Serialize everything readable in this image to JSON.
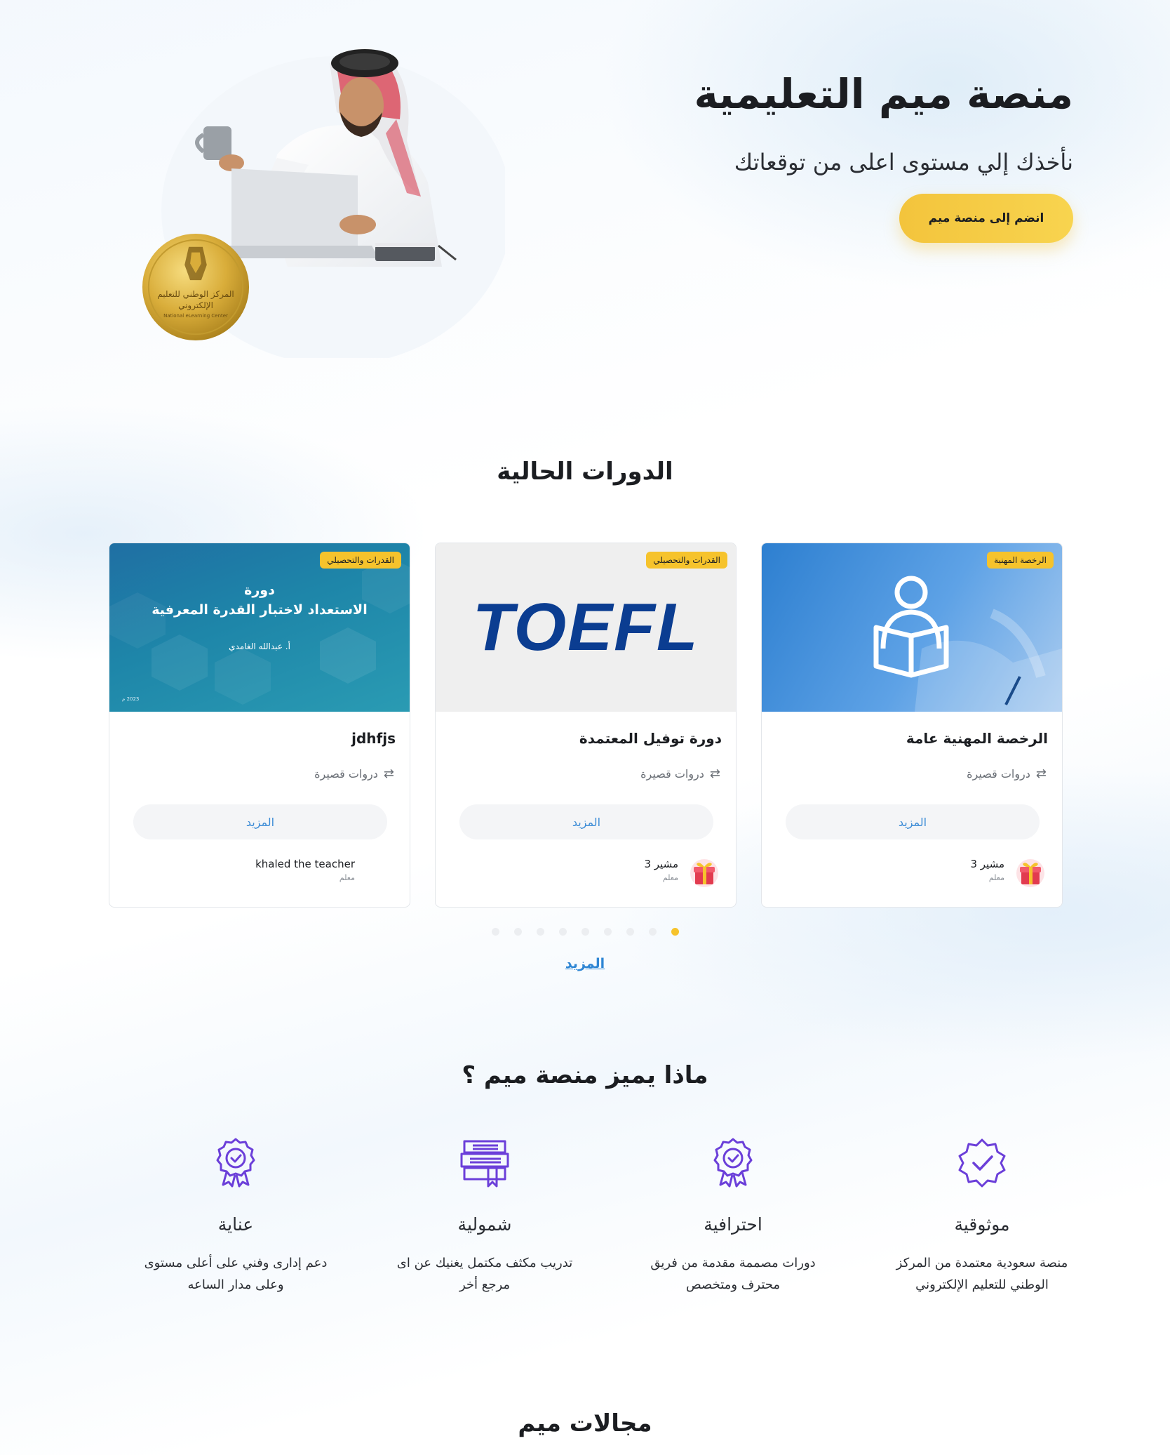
{
  "hero": {
    "title": "منصة ميم التعليمية",
    "subtitle": "نأخذك إلي مستوى اعلى من توقعاتك",
    "join_button": "انضم إلى منصة ميم",
    "badge_text_ar": "المركز الوطني للتعليم الإلكتروني",
    "badge_text_en": "National eLearning Center"
  },
  "courses": {
    "section_title": "الدورات الحالية",
    "items": [
      {
        "tag": "الرخصة المهنية",
        "title": "الرخصة المهنية عامة",
        "meta": "دروات قصيرة",
        "more": "المزيد",
        "instructor_name": "مشير 3",
        "instructor_role": "معلم"
      },
      {
        "tag": "القدرات والتحصيلي",
        "title": "دورة توفيل المعتمدة",
        "meta": "دروات قصيرة",
        "more": "المزيد",
        "instructor_name": "مشير 3",
        "instructor_role": "معلم",
        "image_text": "TOEFL"
      },
      {
        "tag": "القدرات والتحصيلي",
        "title": "jdhfjs",
        "meta": "دروات قصيرة",
        "more": "المزيد",
        "instructor_name": "khaled the teacher",
        "instructor_role": "معلم",
        "image_line1": "دورة",
        "image_line2": "الاستعداد لاختبار القدرة المعرفية",
        "image_author": "أ. عبدالله الغامدي",
        "image_year": "2023 م"
      }
    ],
    "dots_count": 9,
    "active_dot": 0,
    "more_link": "المزيد"
  },
  "features": {
    "section_title": "ماذا يميز منصة ميم ؟",
    "items": [
      {
        "icon": "verified-badge-icon",
        "title": "موثوقية",
        "desc_line1": "منصة سعودية معتمدة من المركز",
        "desc_line2": "الوطني للتعليم الإلكتروني"
      },
      {
        "icon": "award-ribbon-icon",
        "title": "احترافية",
        "desc_line1": "دورات مصممة مقدمة من فريق",
        "desc_line2": "محترف ومتخصص"
      },
      {
        "icon": "books-stack-icon",
        "title": "شمولية",
        "desc_line1": "تدريب مكثف مكتمل يغنيك عن اى",
        "desc_line2": "مرجع أخر"
      },
      {
        "icon": "award-ribbon-icon",
        "title": "عناية",
        "desc_line1": "دعم إدارى وفني على أعلى مستوى",
        "desc_line2": "وعلى مدار الساعه"
      }
    ],
    "icon_color": "#6b3fd9"
  },
  "fields": {
    "section_title": "مجالات ميم"
  },
  "colors": {
    "accent_yellow": "#f6c32c",
    "link_blue": "#2f86d4",
    "toefl_blue": "#0b3d91"
  }
}
